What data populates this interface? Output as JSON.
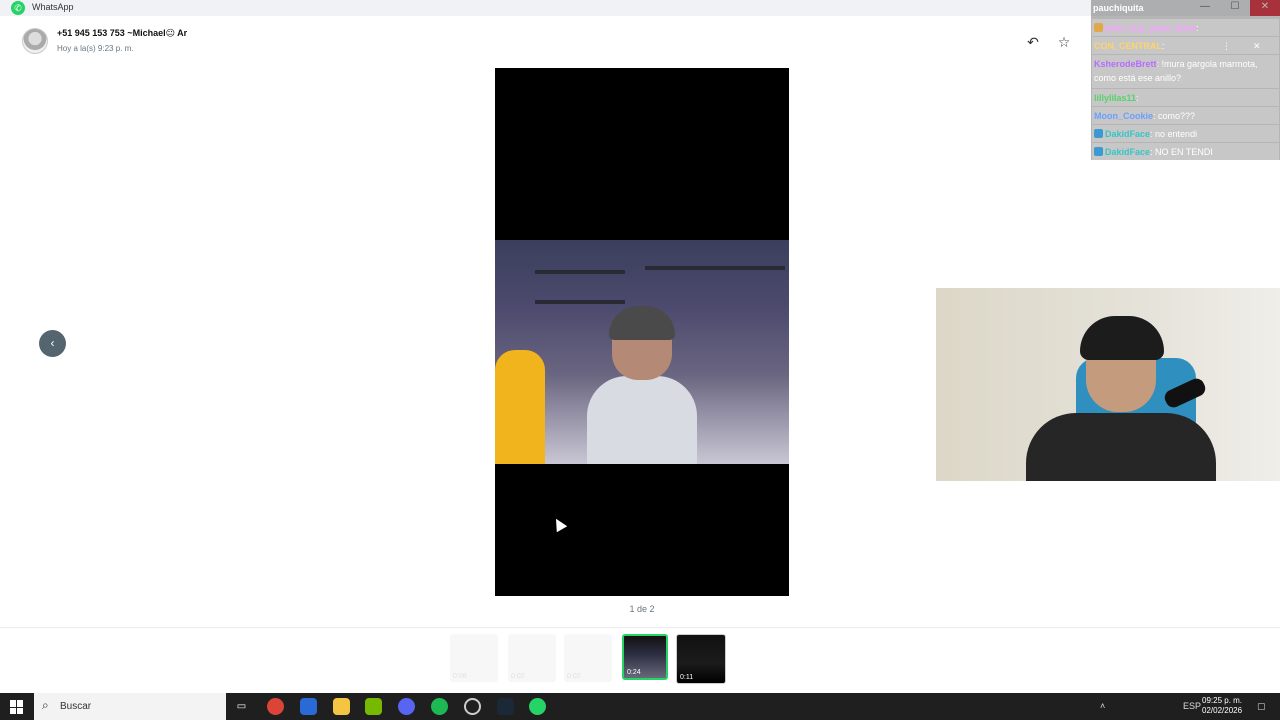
{
  "window": {
    "title": "WhatsApp",
    "min": "—",
    "max": "☐",
    "close": "✕"
  },
  "header": {
    "contact_name": "+51 945 153 753 ~Michael😐 Ar",
    "contact_time": "Hoy a la(s) 9:23 p. m.",
    "reply_icon": "↶",
    "star_icon": "☆"
  },
  "viewer": {
    "prev_icon": "‹",
    "page_counter": "1 de 2"
  },
  "thumbnails": [
    {
      "duration": "0:08",
      "state": "ghost"
    },
    {
      "duration": "0:02",
      "state": "ghost"
    },
    {
      "duration": "0:02",
      "state": "ghost"
    },
    {
      "duration": "0:24",
      "state": "active"
    },
    {
      "duration": "0:11",
      "state": "normal"
    }
  ],
  "chat_overlay": {
    "title": "pauchiquita",
    "top_controls": {
      "dots": "⋮",
      "close": "✕"
    },
    "lines": [
      {
        "user": "plim_bcp_yape_bbva",
        "user_color": "#f5a3ff",
        "text": ":"
      },
      {
        "user": "CON_CENTRAL",
        "user_color": "#ffd36b",
        "text": ":"
      },
      {
        "user": "KsherodeBrett",
        "user_color": "#b86bff",
        "text": ": !mura gargola marmota, como está ese anillo?"
      },
      {
        "user": "lillylilas11",
        "user_color": "#55d36b",
        "text": ":"
      },
      {
        "user": "Moon_Cookie",
        "user_color": "#6aa0ff",
        "text": ": como???"
      },
      {
        "user": "DakidFace",
        "user_color": "#35c6c6",
        "text": ": no entendi"
      },
      {
        "user": "DakidFace",
        "user_color": "#35c6c6",
        "text": ": NO EN TENDI"
      }
    ]
  },
  "taskbar": {
    "search_label": "Buscar",
    "language": "ESP",
    "time": "09:25 p. m.",
    "date": "02/02/2026"
  },
  "colors": {
    "accent": "#25d366",
    "nav_button": "#54656f"
  }
}
